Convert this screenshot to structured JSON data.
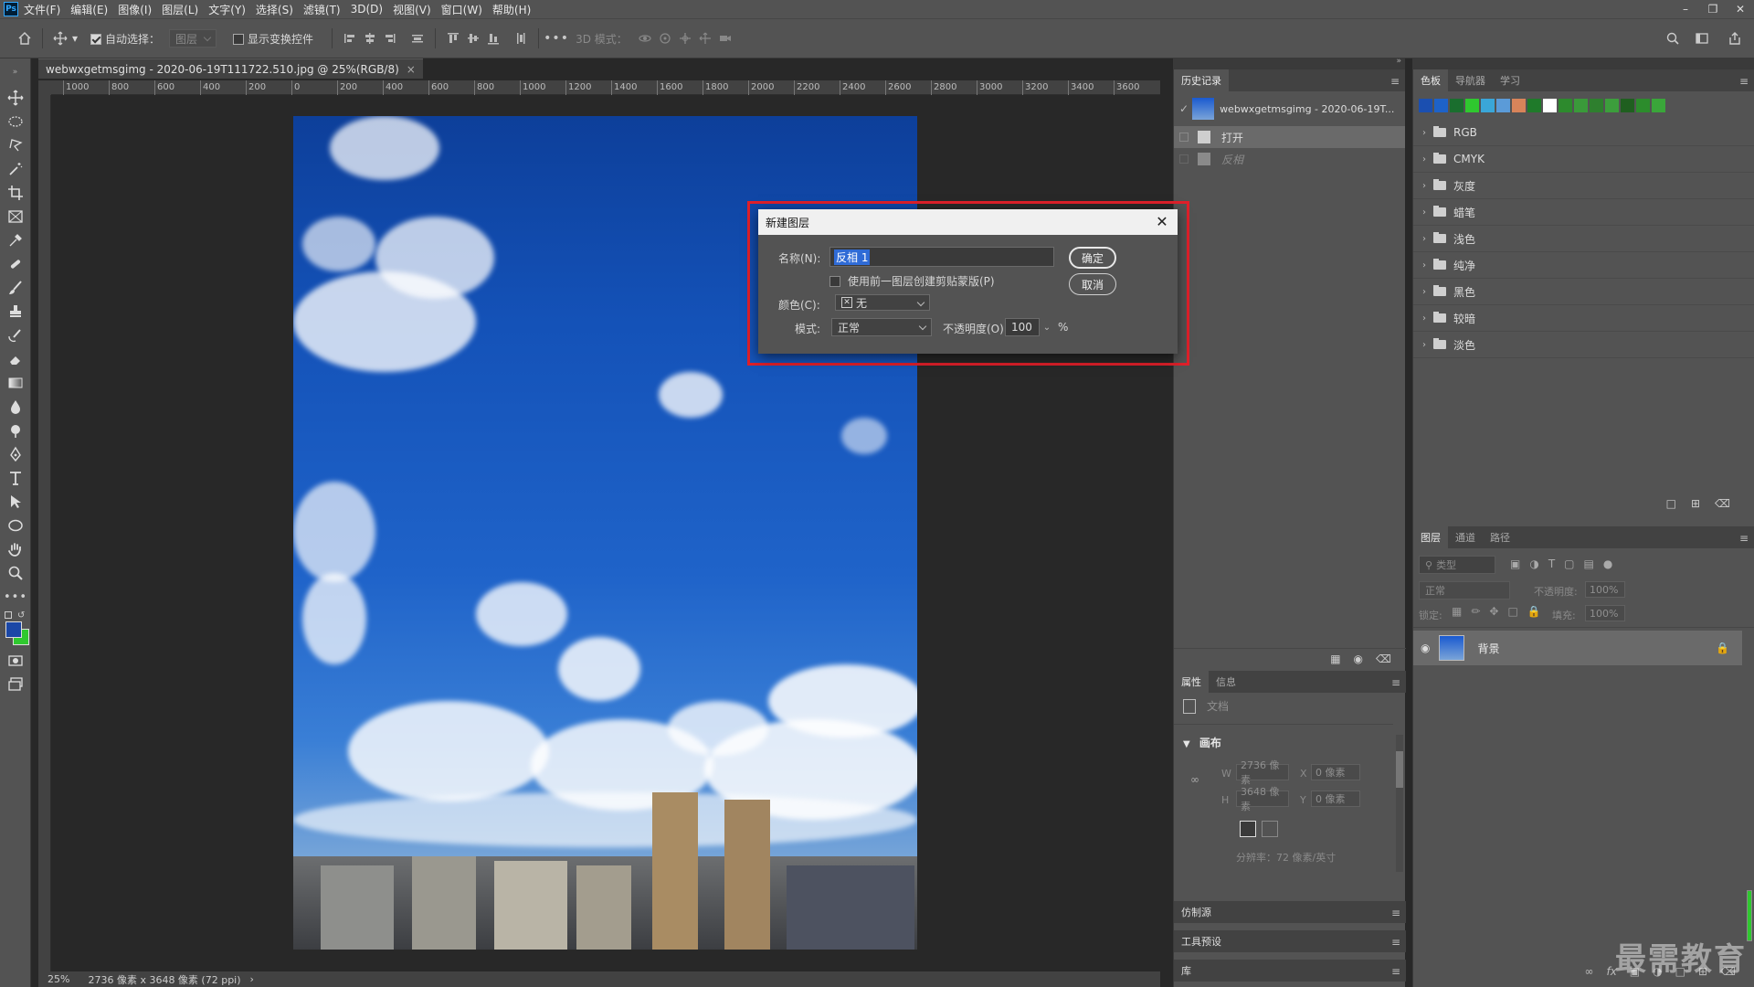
{
  "menubar": {
    "logo": "Ps",
    "items": [
      "文件(F)",
      "编辑(E)",
      "图像(I)",
      "图层(L)",
      "文字(Y)",
      "选择(S)",
      "滤镜(T)",
      "3D(D)",
      "视图(V)",
      "窗口(W)",
      "帮助(H)"
    ]
  },
  "options": {
    "auto_select_label": "自动选择：",
    "auto_select_target": "图层",
    "show_transform_label": "显示变换控件",
    "mode3d_label": "3D 模式："
  },
  "document": {
    "tab_title": "webwxgetmsgimg - 2020-06-19T111722.510.jpg @ 25%(RGB/8)",
    "tab_close": "×",
    "ruler_ticks": [
      "1000",
      "800",
      "600",
      "400",
      "200",
      "0",
      "200",
      "400",
      "600",
      "800",
      "1000",
      "1200",
      "1400",
      "1600",
      "1800",
      "2000",
      "2200",
      "2400",
      "2600",
      "2800",
      "3000",
      "3200",
      "3400",
      "3600"
    ],
    "zoom": "25%",
    "dimensions": "2736 像素 x 3648 像素 (72 ppi)",
    "status_arrow": "›"
  },
  "dialog": {
    "title": "新建图层",
    "name_label": "名称(N):",
    "name_value": "反相 1",
    "clip_label": "使用前一图层创建剪贴蒙版(P)",
    "color_label": "颜色(C):",
    "color_value": "无",
    "mode_label": "模式:",
    "mode_value": "正常",
    "opacity_label": "不透明度(O):",
    "opacity_value": "100",
    "opacity_unit": "%",
    "ok_label": "确定",
    "cancel_label": "取消",
    "highlight_color": "#e0202a"
  },
  "history": {
    "tab": "历史记录",
    "snapshot": "webwxgetmsgimg - 2020-06-19T...",
    "steps": [
      "打开",
      "反相"
    ]
  },
  "properties": {
    "tabs": [
      "属性",
      "信息"
    ],
    "doc_label": "文档",
    "canvas_label": "画布",
    "w_label": "W",
    "w_value": "2736 像素",
    "x_label": "X",
    "x_value": "0 像素",
    "h_label": "H",
    "h_value": "3648 像素",
    "y_label": "Y",
    "y_value": "0 像素",
    "resolution": "分辨率：72 像素/英寸"
  },
  "collapsed_panels": [
    "仿制源",
    "工具预设",
    "库"
  ],
  "swatches": {
    "tabs": [
      "色板",
      "导航器",
      "学习"
    ],
    "colors": [
      "#1b4fb0",
      "#1e62c8",
      "#1a6e2e",
      "#2fc82f",
      "#3aa6d8",
      "#5b9bd8",
      "#d8845a",
      "#1f7a2a",
      "#ffffff",
      "#2d8a2d",
      "#3a9a3a",
      "#2e7f2e",
      "#3c9e3c",
      "#1f5f1f",
      "#2c8c2c",
      "#3aa63a"
    ],
    "folders": [
      "RGB",
      "CMYK",
      "灰度",
      "蜡笔",
      "浅色",
      "纯净",
      "黑色",
      "较暗",
      "淡色"
    ]
  },
  "layers": {
    "tabs": [
      "图层",
      "通道",
      "路径"
    ],
    "filter_placeholder": "类型",
    "blend_mode": "正常",
    "opacity_label": "不透明度:",
    "opacity_value": "100%",
    "lock_label": "锁定:",
    "fill_label": "填充:",
    "fill_value": "100%",
    "items": [
      {
        "name": "背景"
      }
    ]
  },
  "watermark": "最需教育"
}
